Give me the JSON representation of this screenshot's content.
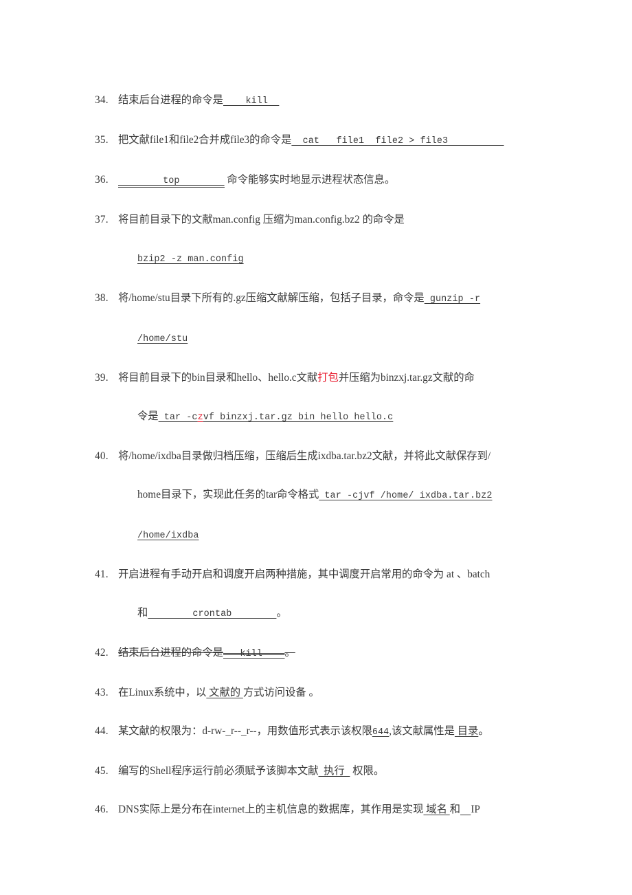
{
  "document": {
    "type": "exam-fill-in-the-blank",
    "subject": "Linux",
    "page_background": "#ffffff",
    "text_color": "#3a3a3a",
    "highlight_color": "#e8192c"
  },
  "questions": [
    {
      "number": "34.",
      "lines": [
        {
          "parts": [
            {
              "kind": "text",
              "text": "结束后台进程的命令是"
            },
            {
              "kind": "answer",
              "text": "    kill  ",
              "mono": true
            }
          ]
        }
      ]
    },
    {
      "number": "35.",
      "lines": [
        {
          "parts": [
            {
              "kind": "text",
              "text": "把文献file1和file2合并成file3的命令是"
            },
            {
              "kind": "answer",
              "text": "  cat   file1  file2 > file3          ",
              "mono": true
            }
          ]
        }
      ]
    },
    {
      "number": "36.",
      "lines": [
        {
          "parts": [
            {
              "kind": "answer-double",
              "text": "        top        ",
              "mono": true
            },
            {
              "kind": "text",
              "text": " 命令能够实时地显示进程状态信息。"
            }
          ]
        }
      ]
    },
    {
      "number": "37.",
      "lines": [
        {
          "parts": [
            {
              "kind": "text",
              "text": "将目前目录下的文献man.config 压缩为man.config.bz2 的命令是"
            }
          ]
        },
        {
          "indent": true,
          "parts": [
            {
              "kind": "answer",
              "text": "bzip2 -z man.config",
              "mono": true
            }
          ]
        }
      ]
    },
    {
      "number": "38.",
      "lines": [
        {
          "parts": [
            {
              "kind": "text",
              "text": "将/home/stu目录下所有的.gz压缩文献解压缩，包括子目录，命令是"
            },
            {
              "kind": "answer",
              "text": " gunzip -r",
              "mono": true
            }
          ]
        },
        {
          "indent": true,
          "parts": [
            {
              "kind": "answer",
              "text": "/home/stu",
              "mono": true
            }
          ]
        }
      ]
    },
    {
      "number": "39.",
      "lines": [
        {
          "parts": [
            {
              "kind": "text",
              "text": "将目前目录下的bin目录和hello、hello.c文献"
            },
            {
              "kind": "red",
              "text": "打包"
            },
            {
              "kind": "text",
              "text": "并压缩为binzxj.tar.gz文献的命"
            }
          ]
        },
        {
          "indent": true,
          "parts": [
            {
              "kind": "text",
              "text": "令是"
            },
            {
              "kind": "answer",
              "text": " tar -c",
              "mono": true
            },
            {
              "kind": "answer-red",
              "text": "z",
              "mono": true
            },
            {
              "kind": "answer",
              "text": "vf binzxj.tar.gz bin hello hello.c",
              "mono": true
            }
          ]
        }
      ]
    },
    {
      "number": "40.",
      "lines": [
        {
          "parts": [
            {
              "kind": "text",
              "text": "将/home/ixdba目录做归档压缩，压缩后生成ixdba.tar.bz2文献，并将此文献保存到/"
            }
          ]
        },
        {
          "indent": true,
          "parts": [
            {
              "kind": "text",
              "text": "home目录下，实现此任务的tar命令格式"
            },
            {
              "kind": "answer",
              "text": " tar -cjvf /home/ ixdba.tar.bz2",
              "mono": true
            }
          ]
        },
        {
          "indent": true,
          "parts": [
            {
              "kind": "answer",
              "text": "/home/ixdba",
              "mono": true
            }
          ]
        }
      ]
    },
    {
      "number": "41.",
      "lines": [
        {
          "parts": [
            {
              "kind": "text",
              "text": "开启进程有手动开启和调度开启两种措施，其中调度开启常用的命令为 at 、batch"
            }
          ]
        },
        {
          "indent": true,
          "parts": [
            {
              "kind": "text",
              "text": "和"
            },
            {
              "kind": "answer",
              "text": "        crontab        ",
              "mono": true
            },
            {
              "kind": "text",
              "text": "。"
            }
          ]
        }
      ]
    },
    {
      "number": "42.",
      "struck": true,
      "lines": [
        {
          "parts": [
            {
              "kind": "text",
              "text": "结束后台进程的命令是"
            },
            {
              "kind": "answer",
              "text": "   kill    ",
              "mono": true
            },
            {
              "kind": "text",
              "text": "。"
            }
          ]
        }
      ]
    },
    {
      "number": "43.",
      "lines": [
        {
          "parts": [
            {
              "kind": "text",
              "text": "在Linux系统中，以"
            },
            {
              "kind": "answer",
              "text": " 文献的 "
            },
            {
              "kind": "text",
              "text": "方式访问设备 。"
            }
          ]
        }
      ]
    },
    {
      "number": "44.",
      "lines": [
        {
          "parts": [
            {
              "kind": "text",
              "text": "某文献的权限为：d-rw-_r--_r--，用数值形式表示该权限"
            },
            {
              "kind": "answer",
              "text": "644",
              "mono": true
            },
            {
              "kind": "text",
              "text": ",该文献属性是"
            },
            {
              "kind": "answer",
              "text": " 目录"
            },
            {
              "kind": "text",
              "text": "。"
            }
          ]
        }
      ]
    },
    {
      "number": "45.",
      "lines": [
        {
          "parts": [
            {
              "kind": "text",
              "text": "编写的Shell程序运行前必须赋予该脚本文献"
            },
            {
              "kind": "answer",
              "text": "  执行  "
            },
            {
              "kind": "text",
              "text": " 权限。"
            }
          ]
        }
      ]
    },
    {
      "number": "46.",
      "lines": [
        {
          "parts": [
            {
              "kind": "text",
              "text": "DNS实际上是分布在internet上的主机信息的数据库，其作用是实现"
            },
            {
              "kind": "answer",
              "text": " 域名 "
            },
            {
              "kind": "text",
              "text": "和"
            },
            {
              "kind": "answer",
              "text": "    "
            },
            {
              "kind": "text",
              "text": "IP"
            }
          ]
        }
      ]
    }
  ]
}
